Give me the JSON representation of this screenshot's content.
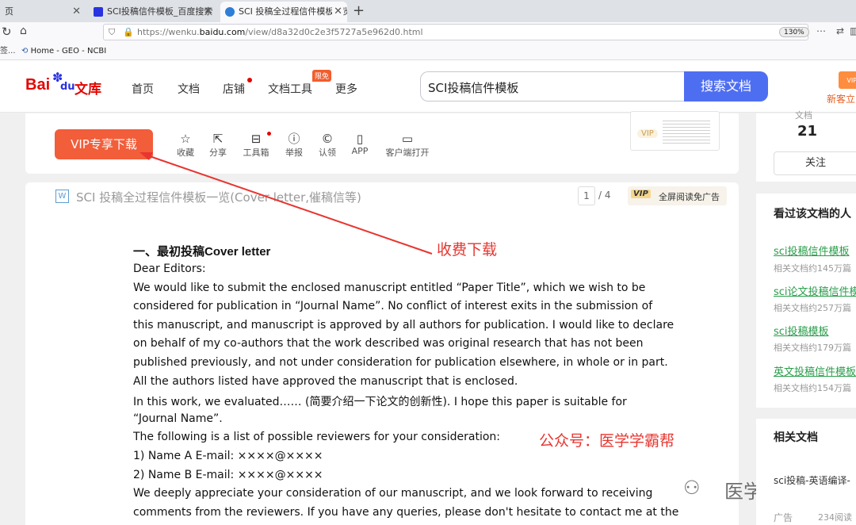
{
  "browser": {
    "tabs": [
      {
        "label": "页"
      },
      {
        "label": "SCI投稿信件模板_百度搜索"
      },
      {
        "label": "SCI 投稿全过程信件模板一览(C"
      }
    ],
    "new_tab": "+",
    "url_prefix": "https://wenku.",
    "url_domain": "baidu.com",
    "url_path": "/view/d8a32d0c2e3f5727a5e962d0.html",
    "zoom": "130%",
    "bookmarks": [
      {
        "label": "Home - GEO - NCBI"
      }
    ],
    "bookmark_left": "签..."
  },
  "header": {
    "logo_bai": "Bai",
    "logo_du": "du",
    "logo_wenku": "文库",
    "nav": [
      "首页",
      "文档",
      "店铺",
      "文档工具",
      "更多"
    ],
    "badge_free": "限免",
    "search_value": "SCI投稿信件模板",
    "search_button": "搜索文档",
    "newcomer": "新客立",
    "vip_tag": "VIP"
  },
  "toolbar": {
    "download_button": "VIP专享下载",
    "tools": [
      {
        "label": "收藏",
        "icon": "star-icon"
      },
      {
        "label": "分享",
        "icon": "share-icon"
      },
      {
        "label": "工具箱",
        "icon": "toolbox-icon"
      },
      {
        "label": "举报",
        "icon": "report-icon"
      },
      {
        "label": "认领",
        "icon": "claim-icon"
      },
      {
        "label": "APP",
        "icon": "phone-icon"
      },
      {
        "label": "客户端打开",
        "icon": "monitor-icon"
      }
    ],
    "thumb_vip": "VIP"
  },
  "doc_header": {
    "title": "SCI 投稿全过程信件模板一览(Cover letter,催稿信等)",
    "page_current": "1",
    "page_total": "/ 4",
    "vip_badge": "VIP",
    "fullscreen_label": "全屏阅读免广告"
  },
  "annotations": {
    "paid_download": "收费下载",
    "public_account": "公众号：医学学霸帮",
    "watermark": "医学学霸帮"
  },
  "document": {
    "heading_cn": "一、最初投稿",
    "heading_en": "Cover  letter",
    "lines": [
      "Dear  Editors:",
      "We  would  like  to  submit  the  enclosed  manuscript  entitled  “Paper  Title”,  which  we  wish  to  be",
      "considered  for  publication  in “Journal  Name”.  No  conflict  of  interest  exits  in  the  submission  of",
      "this  manuscript,  and  manuscript  is  approved  by  all  authors  for  publication.  I  would  like  to  declare",
      "on  behalf  of  my  co-authors  that  the  work  described  was  original  research  that  has  not  been",
      "published  previously,  and  not  under  consideration  for  publication  elsewhere,  in  whole  or  in  part.",
      "All  the  authors  listed  have  approved  the  manuscript  that  is  enclosed.",
      "In  this  work,  we  evaluated……  (简要介绍一下论文的创新性).  I  hope  this  paper  is  suitable  for",
      "“Journal  Name”.",
      "The  following  is  a  list  of  possible  reviewers  for  your  consideration:",
      "1)  Name  A  E-mail:  ××××@××××",
      "2)  Name  B  E-mail:  ××××@××××",
      "We  deeply  appreciate  your  consideration  of  our  manuscript,  and  we  look  forward  to  receiving",
      "comments  from  the  reviewers.  If  you  have  any  queries,  please  don't  hesitate  to  contact  me  at  the"
    ]
  },
  "sidebar": {
    "author_label": "文档",
    "count": "21",
    "follow_button": "关注",
    "viewed_title": "看过该文档的人",
    "related_docs": [
      {
        "title": "sci投稿信件模板",
        "sub": "相关文档约145万篇"
      },
      {
        "title": "sci论文投稿信件模",
        "sub": "相关文档约257万篇"
      },
      {
        "title": "sci投稿模板",
        "sub": "相关文档约179万篇"
      },
      {
        "title": "英文投稿信件模板",
        "sub": "相关文档约154万篇"
      }
    ],
    "related_title": "相关文档",
    "related_item": "sci投稿-英语编译-",
    "ad_label": "广告",
    "ad_reads": "234阅读"
  }
}
